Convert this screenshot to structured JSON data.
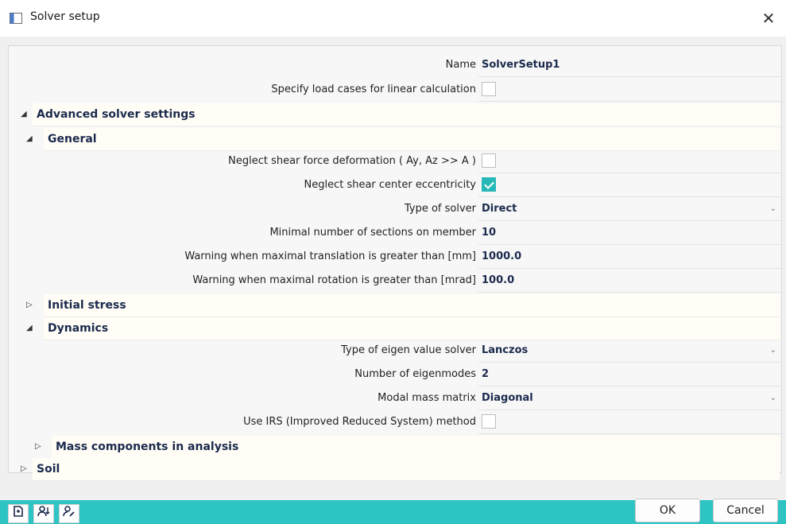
{
  "window": {
    "title": "Solver setup",
    "close_glyph": "✕"
  },
  "rows": {
    "name": {
      "label": "Name",
      "value": "SolverSetup1"
    },
    "specify_load_cases": {
      "label": "Specify load cases for linear calculation",
      "checked": false
    },
    "neglect_shear_force": {
      "label": "Neglect shear force deformation ( Ay, Az >> A )",
      "checked": false
    },
    "neglect_shear_center": {
      "label": "Neglect shear center eccentricity",
      "checked": true
    },
    "type_of_solver": {
      "label": "Type of solver",
      "value": "Direct"
    },
    "min_sections": {
      "label": "Minimal number of sections on member",
      "value": "10"
    },
    "warn_translation": {
      "label": "Warning when maximal translation is greater than [mm]",
      "value": "1000.0"
    },
    "warn_rotation": {
      "label": "Warning when maximal rotation is greater than [mrad]",
      "value": "100.0"
    },
    "eigen_solver": {
      "label": "Type of eigen value solver",
      "value": "Lanczos"
    },
    "num_eigenmodes": {
      "label": "Number of eigenmodes",
      "value": "2"
    },
    "modal_mass": {
      "label": "Modal mass matrix",
      "value": "Diagonal"
    },
    "use_irs": {
      "label": "Use IRS (Improved Reduced System) method",
      "checked": false
    }
  },
  "groups": {
    "advanced": {
      "title": "Advanced solver settings",
      "expanded": true
    },
    "general": {
      "title": "General",
      "expanded": true
    },
    "initial_stress": {
      "title": "Initial stress",
      "expanded": false
    },
    "dynamics": {
      "title": "Dynamics",
      "expanded": true
    },
    "mass_components": {
      "title": "Mass components in analysis",
      "expanded": false
    },
    "soil": {
      "title": "Soil",
      "expanded": false
    }
  },
  "glyphs": {
    "expanded": "◢",
    "collapsed": "▷",
    "dropdown": "⌄"
  },
  "footer": {
    "ok_label": "OK",
    "cancel_label": "Cancel"
  },
  "icons": [
    "document-add-icon",
    "user-sort-icon",
    "user-edit-icon"
  ],
  "colors": {
    "accent": "#2ec4c4",
    "checkbox_on": "#27b7b7",
    "value_text": "#1b2a4d"
  }
}
